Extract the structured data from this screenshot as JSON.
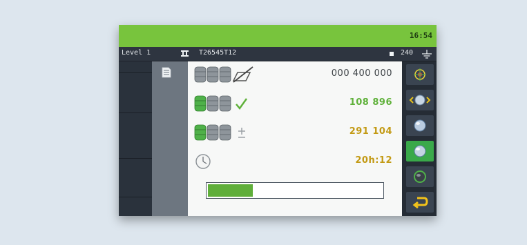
{
  "header": {
    "time": "16:54",
    "level": "Level 1",
    "batch_id": "T26545T12",
    "count": "240"
  },
  "rows": [
    {
      "value": "000 400 000",
      "icon": "coin-stacks-uncounted-icon"
    },
    {
      "value": "108 896",
      "icon": "coin-stacks-completed-icon"
    },
    {
      "value": "291 104",
      "icon": "coin-stacks-remaining-icon"
    },
    {
      "value": "20h:12",
      "icon": "clock-icon"
    }
  ],
  "progress": 0.27,
  "colors": {
    "topbar": "#78c43d",
    "green_value": "#5fb13a",
    "amber_value": "#c39a14",
    "active_button": "#3aa94a"
  },
  "sidebar_buttons": [
    "target-icon",
    "rotate-coin-icon",
    "coin-icon",
    "coin-icon-active",
    "dark-coin-icon",
    "back-arrow-icon"
  ]
}
